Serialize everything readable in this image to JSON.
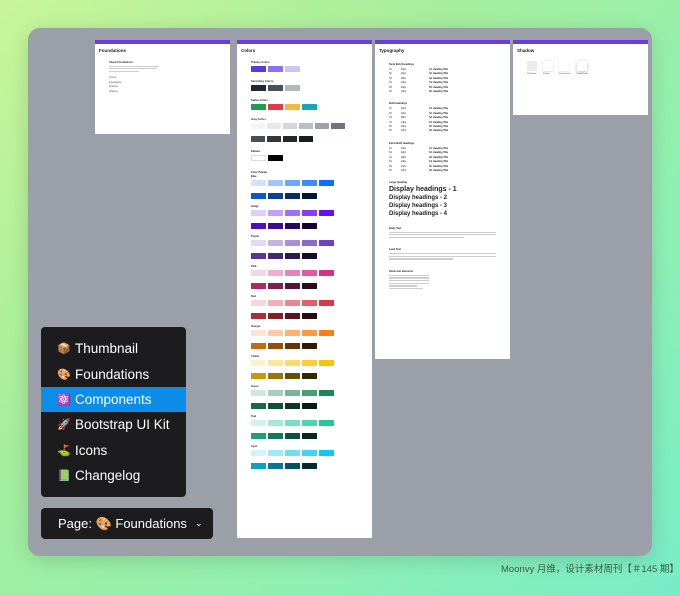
{
  "frames": {
    "foundations": {
      "title": "Foundations",
      "subtitle": "About Foundations",
      "links": [
        "Colors",
        "Typography",
        "Shadow",
        "Spacing"
      ]
    },
    "colors": {
      "title": "Colors",
      "sections": [
        "Primary Colors",
        "Secondary Colors",
        "Status Colors",
        "Gray Colors",
        "Default",
        "Color Palette"
      ],
      "palette_groups": [
        "Blue",
        "Indigo",
        "Purple",
        "Pink",
        "Red",
        "Orange",
        "Yellow",
        "Green",
        "Teal",
        "Cyan"
      ]
    },
    "typography": {
      "title": "Typography",
      "semi_bold": "Semi Bold Headings",
      "bold": "Bold Headings",
      "extra_bold": "Extra Bold Headings",
      "large": "Large Heading",
      "display": [
        "Display headings - 1",
        "Display headings - 2",
        "Display headings - 3",
        "Display headings - 4"
      ],
      "body": "Body Text",
      "lead": "Lead Text",
      "inline": "Inline text elements",
      "rows": [
        {
          "tag": "h1",
          "size": "40px",
          "label": "h1. Heading Title"
        },
        {
          "tag": "h2",
          "size": "32px",
          "label": "h2. Heading Title"
        },
        {
          "tag": "h3",
          "size": "28px",
          "label": "h3. Heading Title"
        },
        {
          "tag": "h4",
          "size": "24px",
          "label": "h4. Heading Title"
        },
        {
          "tag": "h5",
          "size": "20px",
          "label": "h5. Heading Title"
        },
        {
          "tag": "h6",
          "size": "16px",
          "label": "h6. Heading Title"
        }
      ]
    },
    "shadow": {
      "title": "Shadow",
      "items": [
        "No Shadow",
        "Shadow",
        "Shadow Small",
        "Shadow Large"
      ]
    }
  },
  "menu": {
    "items": [
      {
        "icon": "📦",
        "label": "Thumbnail",
        "active": false
      },
      {
        "icon": "🎨",
        "label": "Foundations",
        "active": false
      },
      {
        "icon": "⚛️",
        "label": "Components",
        "active": true
      },
      {
        "icon": "🚀",
        "label": "Bootstrap UI Kit",
        "active": false
      },
      {
        "icon": "⛳",
        "label": "Icons",
        "active": false
      },
      {
        "icon": "📗",
        "label": "Changelog",
        "active": false
      }
    ]
  },
  "page_select": {
    "label": "Page: 🎨 Foundations",
    "chevron": "chevron-down-icon"
  },
  "credit": "Moonvy 月维，设计素材周刊【＃145 期】",
  "colors_swatches": {
    "primary": [
      "#5b3bd8",
      "#8f6ef0",
      "#cfc3f6"
    ],
    "secondary": [
      "#222831",
      "#4a5059",
      "#b3b8c0"
    ],
    "status": [
      "#1e9e4a",
      "#e03a4a",
      "#f5b73b",
      "#1aa5b8"
    ],
    "gray": [
      "#f4f5f7",
      "#e6e8eb",
      "#d4d7dc",
      "#bcc0c6",
      "#9ea3ab",
      "#6f757d",
      "#4a4f57",
      "#33373d",
      "#24272c",
      "#1a1c20"
    ],
    "default": [
      "#ffffff",
      "#000000"
    ],
    "palette": {
      "Blue": [
        "#cfe2ff",
        "#9ec5fe",
        "#6ea8fe",
        "#3d8bfd",
        "#0d6efd",
        "#0a58ca",
        "#084298",
        "#052c65",
        "#031633"
      ],
      "Indigo": [
        "#e0cffc",
        "#c29ffa",
        "#a370f7",
        "#8540f5",
        "#6610f2",
        "#520dc2",
        "#3d0a91",
        "#290661",
        "#140330"
      ],
      "Purple": [
        "#e2d9f3",
        "#c5b3e6",
        "#a98eda",
        "#8c68cd",
        "#6f42c1",
        "#59359a",
        "#432874",
        "#2c1a4d",
        "#160d27"
      ],
      "Pink": [
        "#f7d6e6",
        "#efadce",
        "#e685b5",
        "#de5c9d",
        "#d63384",
        "#ab296a",
        "#801f4f",
        "#561435",
        "#2b0a1a"
      ],
      "Red": [
        "#f8d7da",
        "#f1aeb5",
        "#ea868f",
        "#e35d6a",
        "#dc3545",
        "#b02a37",
        "#842029",
        "#58151c",
        "#2c0b0e"
      ],
      "Orange": [
        "#ffe5d0",
        "#fecba1",
        "#feb272",
        "#fd9843",
        "#fd7e14",
        "#ca6510",
        "#984c0c",
        "#653208",
        "#331904"
      ],
      "Yellow": [
        "#fff3cd",
        "#ffe69c",
        "#ffda6a",
        "#ffcd39",
        "#ffc107",
        "#cc9a06",
        "#997404",
        "#664d03",
        "#332701"
      ],
      "Green": [
        "#d1e7dd",
        "#a3cfbb",
        "#75b798",
        "#479f76",
        "#198754",
        "#146c43",
        "#0f5132",
        "#0a3622",
        "#051b11"
      ],
      "Teal": [
        "#d2f4ea",
        "#a6e9d5",
        "#79dfc1",
        "#4dd4ac",
        "#20c997",
        "#1aa179",
        "#13795b",
        "#0d503c",
        "#06281e"
      ],
      "Cyan": [
        "#cff4fc",
        "#9eeaf9",
        "#6edff6",
        "#3dd5f3",
        "#0dcaf0",
        "#0aa2c0",
        "#087990",
        "#055160",
        "#032830"
      ]
    }
  }
}
